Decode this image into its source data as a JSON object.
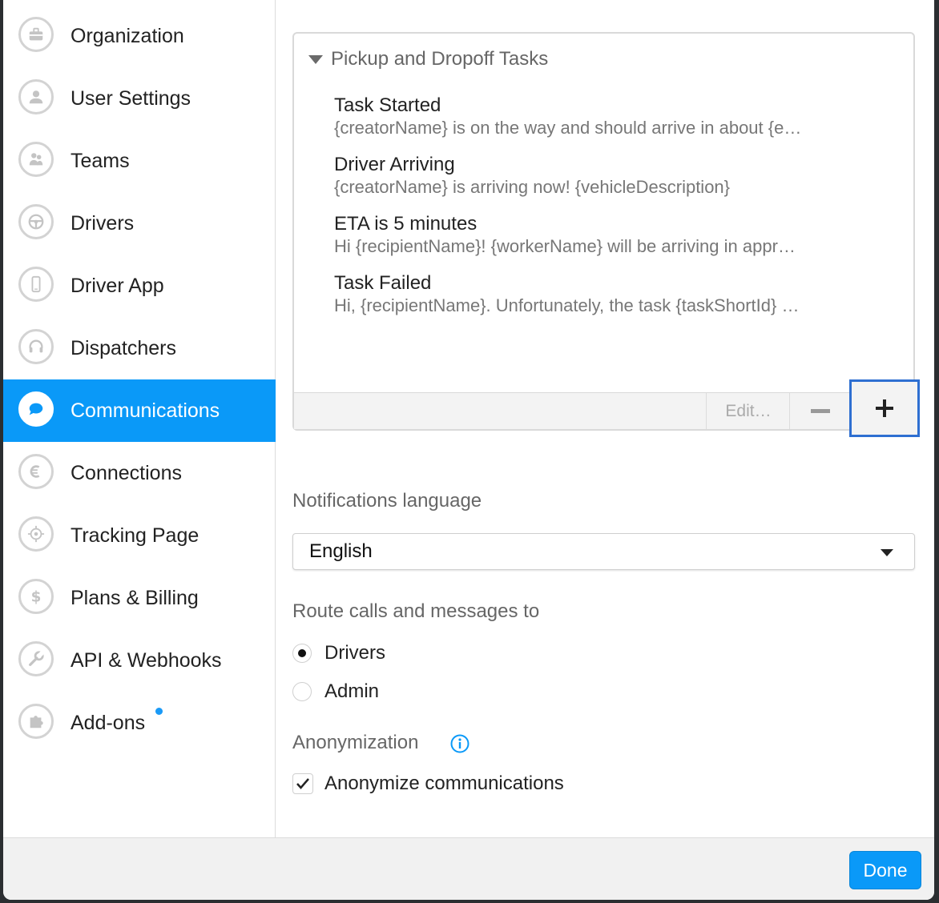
{
  "sidebar": {
    "items": [
      {
        "label": "Organization",
        "icon": "briefcase-icon"
      },
      {
        "label": "User Settings",
        "icon": "user-icon"
      },
      {
        "label": "Teams",
        "icon": "team-icon"
      },
      {
        "label": "Drivers",
        "icon": "steering-wheel-icon"
      },
      {
        "label": "Driver App",
        "icon": "phone-icon"
      },
      {
        "label": "Dispatchers",
        "icon": "headset-icon"
      },
      {
        "label": "Communications",
        "icon": "chat-bubble-icon",
        "active": true
      },
      {
        "label": "Connections",
        "icon": "connections-icon"
      },
      {
        "label": "Tracking Page",
        "icon": "crosshair-icon"
      },
      {
        "label": "Plans & Billing",
        "icon": "dollar-icon"
      },
      {
        "label": "API & Webhooks",
        "icon": "wrench-icon"
      },
      {
        "label": "Add-ons",
        "icon": "puzzle-icon",
        "badge": "new-dot"
      }
    ]
  },
  "tasks_panel": {
    "header": "Pickup and Dropoff Tasks",
    "tasks": [
      {
        "title": "Task Started",
        "description": "{creatorName} is on the way and should arrive in about {e…"
      },
      {
        "title": "Driver Arriving",
        "description": "{creatorName} is arriving now! {vehicleDescription}"
      },
      {
        "title": "ETA is 5 minutes",
        "description": "Hi {recipientName}! {workerName} will be arriving in appr…"
      },
      {
        "title": "Task Failed",
        "description": "Hi, {recipientName}. Unfortunately, the task {taskShortId} …"
      }
    ],
    "toolbar": {
      "edit_label": "Edit…",
      "remove_label": "−",
      "add_label": "+"
    }
  },
  "notifications_language": {
    "label": "Notifications language",
    "selected": "English"
  },
  "route": {
    "label": "Route calls and messages to",
    "options": [
      {
        "label": "Drivers",
        "selected": true
      },
      {
        "label": "Admin",
        "selected": false
      }
    ]
  },
  "anonymization": {
    "label": "Anonymization",
    "checkbox_label": "Anonymize communications",
    "checked": true
  },
  "footer": {
    "done_label": "Done"
  },
  "colors": {
    "accent": "#0a99f8",
    "highlight_border": "#2e6fd1"
  }
}
